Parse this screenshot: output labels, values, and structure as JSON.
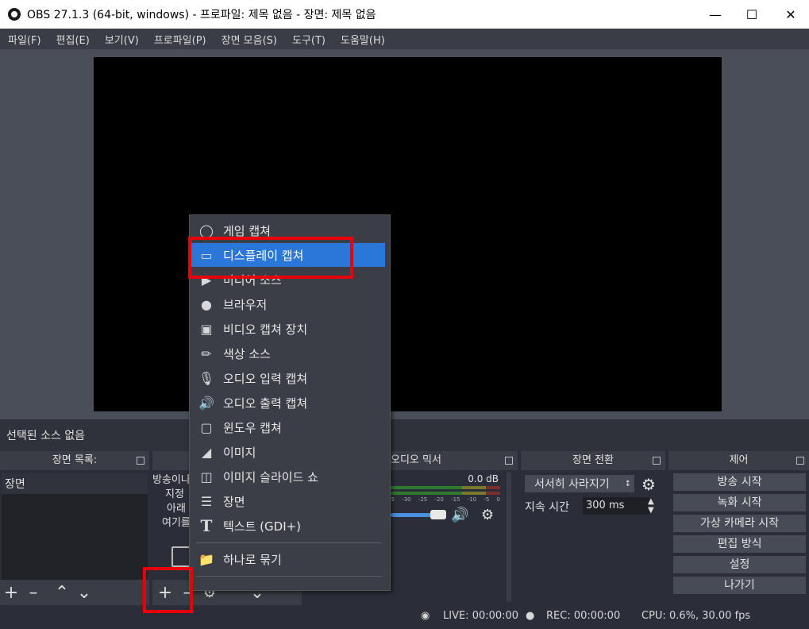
{
  "window": {
    "title": "OBS 27.1.3 (64-bit, windows) - 프로파일: 제목 없음 - 장면: 제목 없음"
  },
  "menubar": [
    "파일(F)",
    "편집(E)",
    "보기(V)",
    "프로파일(P)",
    "장면 모음(S)",
    "도구(T)",
    "도움말(H)"
  ],
  "status": {
    "no_source": "선택된 소스 없음"
  },
  "scenes": {
    "title": "장면 목록:",
    "items": [
      "장면"
    ]
  },
  "sources": {
    "hint_lines": [
      "방송이나",
      "지정",
      "아래",
      "여기를"
    ]
  },
  "mixer": {
    "title": "오디오 믹서",
    "level": "0.0 dB",
    "scale": [
      "-5",
      "-30",
      "-25",
      "-20",
      "-15",
      "-10",
      "-5",
      "0"
    ]
  },
  "transitions": {
    "title": "장면 전환",
    "selected": "서서히 사라지기",
    "duration_label": "지속 시간",
    "duration_value": "300 ms"
  },
  "controls": {
    "title": "제어",
    "buttons": [
      "방송 시작",
      "녹화 시작",
      "가상 카메라 시작",
      "편집 방식",
      "설정",
      "나가기"
    ]
  },
  "bottom": {
    "live": "LIVE: 00:00:00",
    "rec": "REC: 00:00:00",
    "cpu": "CPU: 0.6%, 30.00 fps"
  },
  "add_menu": {
    "items": [
      {
        "label": "게임 캡쳐",
        "icon": "gamepad-icon"
      },
      {
        "label": "디스플레이 캡쳐",
        "icon": "monitor-icon"
      },
      {
        "label": "미디어 소스",
        "icon": "play-icon"
      },
      {
        "label": "브라우저",
        "icon": "globe-icon"
      },
      {
        "label": "비디오 캡쳐 장치",
        "icon": "camera-icon"
      },
      {
        "label": "색상 소스",
        "icon": "brush-icon"
      },
      {
        "label": "오디오 입력 캡쳐",
        "icon": "microphone-icon"
      },
      {
        "label": "오디오 출력 캡쳐",
        "icon": "speaker-icon"
      },
      {
        "label": "윈도우 캡쳐",
        "icon": "window-icon"
      },
      {
        "label": "이미지",
        "icon": "image-icon"
      },
      {
        "label": "이미지 슬라이드 쇼",
        "icon": "slideshow-icon"
      },
      {
        "label": "장면",
        "icon": "list-icon"
      },
      {
        "label": "텍스트 (GDI+)",
        "icon": "text-icon"
      },
      {
        "label": "하나로 묶기",
        "icon": "folder-icon"
      }
    ]
  },
  "colors": {
    "highlight": "#2b77d9",
    "annotation": "#e8000b"
  }
}
